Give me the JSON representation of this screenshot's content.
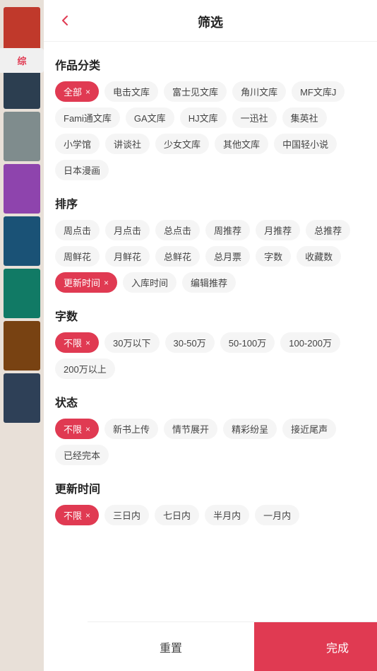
{
  "header": {
    "title": "筛选",
    "back_icon": "‹"
  },
  "sections": [
    {
      "id": "category",
      "title": "作品分类",
      "tags": [
        {
          "label": "全部",
          "active": true,
          "closable": true
        },
        {
          "label": "电击文库",
          "active": false,
          "closable": false
        },
        {
          "label": "富士见文库",
          "active": false,
          "closable": false
        },
        {
          "label": "角川文库",
          "active": false,
          "closable": false
        },
        {
          "label": "MF文库J",
          "active": false,
          "closable": false
        },
        {
          "label": "Fami通文库",
          "active": false,
          "closable": false
        },
        {
          "label": "GA文库",
          "active": false,
          "closable": false
        },
        {
          "label": "HJ文库",
          "active": false,
          "closable": false
        },
        {
          "label": "一迅社",
          "active": false,
          "closable": false
        },
        {
          "label": "集英社",
          "active": false,
          "closable": false
        },
        {
          "label": "小学馆",
          "active": false,
          "closable": false
        },
        {
          "label": "讲谈社",
          "active": false,
          "closable": false
        },
        {
          "label": "少女文库",
          "active": false,
          "closable": false
        },
        {
          "label": "其他文库",
          "active": false,
          "closable": false
        },
        {
          "label": "中国轻小说",
          "active": false,
          "closable": false
        },
        {
          "label": "日本漫画",
          "active": false,
          "closable": false
        }
      ]
    },
    {
      "id": "sort",
      "title": "排序",
      "tags": [
        {
          "label": "周点击",
          "active": false,
          "closable": false
        },
        {
          "label": "月点击",
          "active": false,
          "closable": false
        },
        {
          "label": "总点击",
          "active": false,
          "closable": false
        },
        {
          "label": "周推荐",
          "active": false,
          "closable": false
        },
        {
          "label": "月推荐",
          "active": false,
          "closable": false
        },
        {
          "label": "总推荐",
          "active": false,
          "closable": false
        },
        {
          "label": "周鲜花",
          "active": false,
          "closable": false
        },
        {
          "label": "月鲜花",
          "active": false,
          "closable": false
        },
        {
          "label": "总鲜花",
          "active": false,
          "closable": false
        },
        {
          "label": "总月票",
          "active": false,
          "closable": false
        },
        {
          "label": "字数",
          "active": false,
          "closable": false
        },
        {
          "label": "收藏数",
          "active": false,
          "closable": false
        },
        {
          "label": "更新时间",
          "active": true,
          "closable": true
        },
        {
          "label": "入库时间",
          "active": false,
          "closable": false
        },
        {
          "label": "编辑推荐",
          "active": false,
          "closable": false
        }
      ]
    },
    {
      "id": "wordcount",
      "title": "字数",
      "tags": [
        {
          "label": "不限",
          "active": true,
          "closable": true
        },
        {
          "label": "30万以下",
          "active": false,
          "closable": false
        },
        {
          "label": "30-50万",
          "active": false,
          "closable": false
        },
        {
          "label": "50-100万",
          "active": false,
          "closable": false
        },
        {
          "label": "100-200万",
          "active": false,
          "closable": false
        },
        {
          "label": "200万以上",
          "active": false,
          "closable": false
        }
      ]
    },
    {
      "id": "status",
      "title": "状态",
      "tags": [
        {
          "label": "不限",
          "active": true,
          "closable": true
        },
        {
          "label": "新书上传",
          "active": false,
          "closable": false
        },
        {
          "label": "情节展开",
          "active": false,
          "closable": false
        },
        {
          "label": "精彩纷呈",
          "active": false,
          "closable": false
        },
        {
          "label": "接近尾声",
          "active": false,
          "closable": false
        },
        {
          "label": "已经完本",
          "active": false,
          "closable": false
        }
      ]
    },
    {
      "id": "updatetime",
      "title": "更新时间",
      "tags": [
        {
          "label": "不限",
          "active": true,
          "closable": true
        },
        {
          "label": "三日内",
          "active": false,
          "closable": false
        },
        {
          "label": "七日内",
          "active": false,
          "closable": false
        },
        {
          "label": "半月内",
          "active": false,
          "closable": false
        },
        {
          "label": "一月内",
          "active": false,
          "closable": false
        }
      ]
    }
  ],
  "footer": {
    "reset_label": "重置",
    "confirm_label": "完成"
  },
  "sidebar": {
    "tab_label": "综",
    "books": [
      {
        "color": "#c0392b"
      },
      {
        "color": "#2c3e50"
      },
      {
        "color": "#7f8c8d"
      },
      {
        "color": "#8e44ad"
      },
      {
        "color": "#1a5276"
      },
      {
        "color": "#117a65"
      },
      {
        "color": "#784212"
      },
      {
        "color": "#2e4057"
      }
    ]
  }
}
